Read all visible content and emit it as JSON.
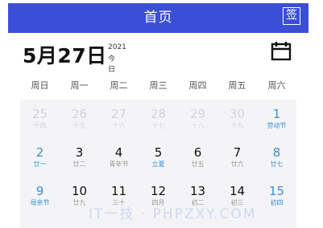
{
  "header": {
    "title": "首页",
    "sign_label": "签"
  },
  "current_date": {
    "big": "5月27日",
    "year": "2021",
    "today": "今日"
  },
  "icons": {
    "calendar": "calendar-icon"
  },
  "colors": {
    "header_bg": "#3b4ed6",
    "weekend_number": "#3a8fd6",
    "holiday_label": "#3a8fd6",
    "grid_bg": "#f4f4f6"
  },
  "weekdays": [
    "周日",
    "周一",
    "周二",
    "周三",
    "周四",
    "周五",
    "周六"
  ],
  "weeks": [
    [
      {
        "day": "25",
        "lunar": "十四",
        "dim": true,
        "weekend": false,
        "holiday": false
      },
      {
        "day": "26",
        "lunar": "十五",
        "dim": true,
        "weekend": false,
        "holiday": false
      },
      {
        "day": "27",
        "lunar": "十六",
        "dim": true,
        "weekend": false,
        "holiday": false
      },
      {
        "day": "28",
        "lunar": "十七",
        "dim": true,
        "weekend": false,
        "holiday": false
      },
      {
        "day": "29",
        "lunar": "十八",
        "dim": true,
        "weekend": false,
        "holiday": false
      },
      {
        "day": "30",
        "lunar": "十九",
        "dim": true,
        "weekend": false,
        "holiday": false
      },
      {
        "day": "1",
        "lunar": "劳动节",
        "dim": false,
        "weekend": true,
        "holiday": true
      }
    ],
    [
      {
        "day": "2",
        "lunar": "廿一",
        "dim": false,
        "weekend": true,
        "holiday": true
      },
      {
        "day": "3",
        "lunar": "廿二",
        "dim": false,
        "weekend": false,
        "holiday": false
      },
      {
        "day": "4",
        "lunar": "青年节",
        "dim": false,
        "weekend": false,
        "holiday": false
      },
      {
        "day": "5",
        "lunar": "立夏",
        "dim": false,
        "weekend": false,
        "holiday": true
      },
      {
        "day": "6",
        "lunar": "廿五",
        "dim": false,
        "weekend": false,
        "holiday": false
      },
      {
        "day": "7",
        "lunar": "廿六",
        "dim": false,
        "weekend": false,
        "holiday": false
      },
      {
        "day": "8",
        "lunar": "廿七",
        "dim": false,
        "weekend": true,
        "holiday": true
      }
    ],
    [
      {
        "day": "9",
        "lunar": "母亲节",
        "dim": false,
        "weekend": true,
        "holiday": true
      },
      {
        "day": "10",
        "lunar": "廿九",
        "dim": false,
        "weekend": false,
        "holiday": false
      },
      {
        "day": "11",
        "lunar": "三十",
        "dim": false,
        "weekend": false,
        "holiday": false
      },
      {
        "day": "12",
        "lunar": "四月",
        "dim": false,
        "weekend": false,
        "holiday": false
      },
      {
        "day": "13",
        "lunar": "初二",
        "dim": false,
        "weekend": false,
        "holiday": false
      },
      {
        "day": "14",
        "lunar": "初三",
        "dim": false,
        "weekend": false,
        "holiday": false
      },
      {
        "day": "15",
        "lunar": "初四",
        "dim": false,
        "weekend": true,
        "holiday": true
      }
    ]
  ],
  "watermark": "IT一技 · PHPZXY.COM"
}
